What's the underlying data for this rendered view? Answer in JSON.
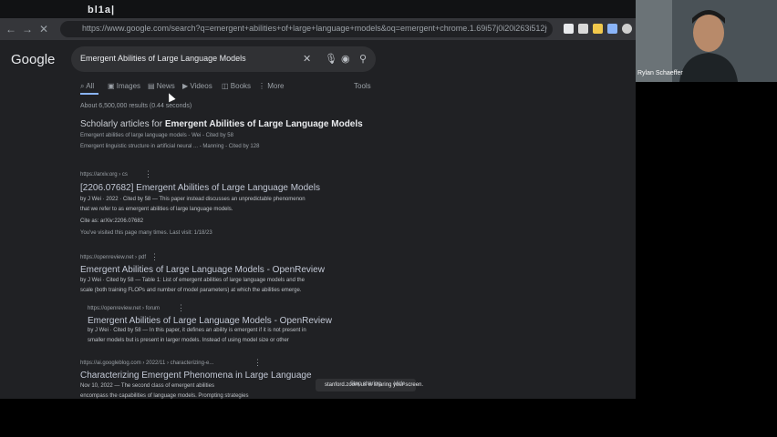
{
  "browser": {
    "tab_title": "bl1a|",
    "url": "https://www.google.com/search?q=emergent+abilities+of+large+language+models&oq=emergent+chrome.1.69i57j0i20i263i512j0i512.3122j0j4&sourceid=chrome&ie=UTF-8"
  },
  "google": {
    "logo": "Google",
    "query": "Emergent Abilities of Large Language Models",
    "tabs": [
      "All",
      "Images",
      "News",
      "Videos",
      "Books",
      "More"
    ],
    "tools_label": "Tools",
    "stats": "About 6,500,000 results (0.44 seconds)"
  },
  "scholarly": {
    "heading_prefix": "Scholarly articles for ",
    "heading_bold": "Emergent Abilities of Large Language Models",
    "line1": "Emergent abilities of large language models - Wei - Cited by 58",
    "line2": "Emergent linguistic structure in artificial neural ... - Manning - Cited by 128"
  },
  "results": [
    {
      "source": "https://arxiv.org › cs",
      "title": "[2206.07682] Emergent Abilities of Large Language Models",
      "meta": "by J Wei · 2022 · Cited by 58 — This paper instead discusses an unpredictable phenomenon",
      "snippet": "that we refer to as emergent abilities of large language models.",
      "extra": "Cite as: arXiv:2206.07682",
      "visited": "You've visited this page many times. Last visit: 1/18/23"
    },
    {
      "source": "https://openreview.net › pdf",
      "title": "Emergent Abilities of Large Language Models - OpenReview",
      "meta": "by J Wei · Cited by 58 — Table 1: List of emergent abilities of large language models and the",
      "snippet": "scale (both training FLOPs and number of model parameters) at which the abilities emerge."
    },
    {
      "source": "https://openreview.net › forum",
      "title": "Emergent Abilities of Large Language Models - OpenReview",
      "meta": "by J Wei · Cited by 58 — In this paper, it defines an ability is emergent if it is not present in",
      "snippet": "smaller models but is present in larger models. Instead of using model size or other"
    },
    {
      "source": "https://ai.googleblog.com › 2022/11 › characterizing-e...",
      "title": "Characterizing Emergent Phenomena in Large Language",
      "meta": "Nov 10, 2022 — The second class of emergent abilities",
      "snippet": "encompass the capabilities of language models. Prompting strategies"
    }
  ],
  "share": {
    "message": "stanford.zoom.us is sharing your screen.",
    "stop_label": "Stop sharing",
    "hide_label": "Hide"
  },
  "webcam": {
    "name": "Rylan Schaeffer"
  },
  "icons": {
    "back": "back-arrow-icon",
    "forward": "forward-arrow-icon",
    "reload": "reload-icon",
    "clear": "clear-x-icon",
    "mic": "microphone-icon",
    "lens": "camera-lens-icon",
    "search": "search-icon"
  }
}
